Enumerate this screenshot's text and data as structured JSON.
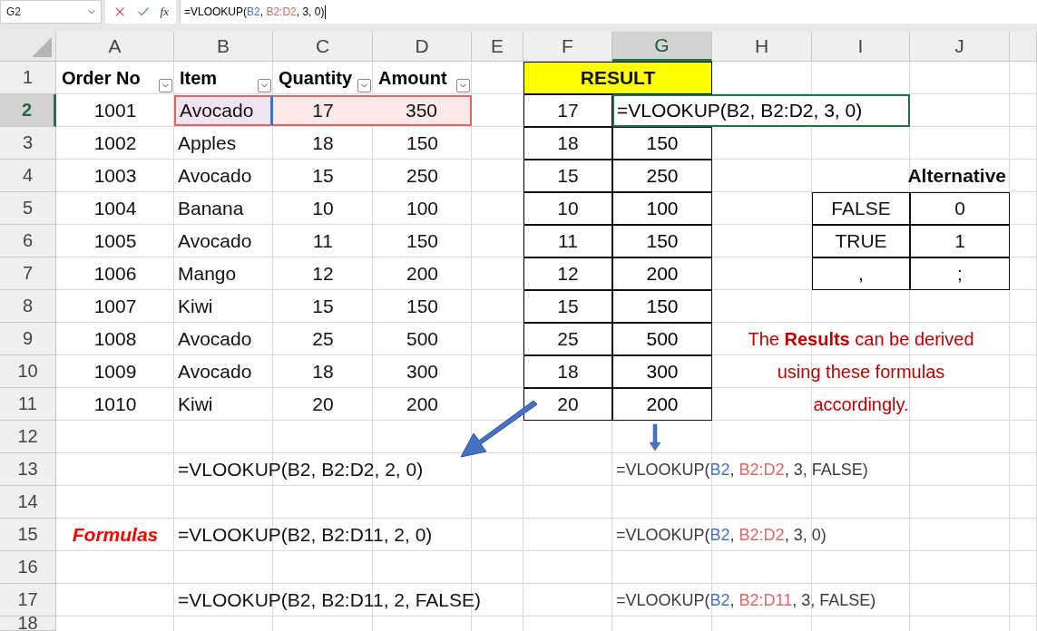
{
  "name_box": {
    "value": "G2"
  },
  "formula_bar": {
    "function_label": "fx",
    "formula": {
      "head": "=VLOOKUP(",
      "lookup_value": "B2",
      "separator": ", ",
      "table_array": "B2:D2",
      "tail": ", 3, 0)"
    }
  },
  "columns": [
    {
      "label": "A",
      "selected": false
    },
    {
      "label": "B",
      "selected": false
    },
    {
      "label": "C",
      "selected": false
    },
    {
      "label": "D",
      "selected": false
    },
    {
      "label": "E",
      "selected": false
    },
    {
      "label": "F",
      "selected": false
    },
    {
      "label": "G",
      "selected": true
    },
    {
      "label": "H",
      "selected": false
    },
    {
      "label": "I",
      "selected": false
    },
    {
      "label": "J",
      "selected": false
    }
  ],
  "rows": [
    {
      "label": "1",
      "selected": false
    },
    {
      "label": "2",
      "selected": true
    },
    {
      "label": "3",
      "selected": false
    },
    {
      "label": "4",
      "selected": false
    },
    {
      "label": "5",
      "selected": false
    },
    {
      "label": "6",
      "selected": false
    },
    {
      "label": "7",
      "selected": false
    },
    {
      "label": "8",
      "selected": false
    },
    {
      "label": "9",
      "selected": false
    },
    {
      "label": "10",
      "selected": false
    },
    {
      "label": "11",
      "selected": false
    },
    {
      "label": "12",
      "selected": false
    },
    {
      "label": "13",
      "selected": false
    },
    {
      "label": "14",
      "selected": false
    },
    {
      "label": "15",
      "selected": false
    },
    {
      "label": "16",
      "selected": false
    },
    {
      "label": "17",
      "selected": false
    },
    {
      "label": "18",
      "selected": false
    }
  ],
  "orders": {
    "headers": [
      "Order No",
      "Item",
      "Quantity",
      "Amount"
    ],
    "rows": [
      {
        "highlighted": true,
        "cells": [
          "1001",
          "Avocado",
          "17",
          "350"
        ]
      },
      {
        "highlighted": false,
        "cells": [
          "1002",
          "Apples",
          "18",
          "150"
        ]
      },
      {
        "highlighted": false,
        "cells": [
          "1003",
          "Avocado",
          "15",
          "250"
        ]
      },
      {
        "highlighted": false,
        "cells": [
          "1004",
          "Banana",
          "10",
          "100"
        ]
      },
      {
        "highlighted": false,
        "cells": [
          "1005",
          "Avocado",
          "11",
          "150"
        ]
      },
      {
        "highlighted": false,
        "cells": [
          "1006",
          "Mango",
          "12",
          "200"
        ]
      },
      {
        "highlighted": false,
        "cells": [
          "1007",
          "Kiwi",
          "15",
          "150"
        ]
      },
      {
        "highlighted": false,
        "cells": [
          "1008",
          "Avocado",
          "25",
          "500"
        ]
      },
      {
        "highlighted": false,
        "cells": [
          "1009",
          "Avocado",
          "18",
          "300"
        ]
      },
      {
        "highlighted": false,
        "cells": [
          "1010",
          "Kiwi",
          "20",
          "200"
        ]
      }
    ]
  },
  "result": {
    "title": "RESULT",
    "rows": [
      {
        "quantity": "17",
        "amount": "=VLOOKUP(B2, B2:D2, 3, 0)",
        "editing": true
      },
      {
        "quantity": "18",
        "amount": "150",
        "editing": false
      },
      {
        "quantity": "15",
        "amount": "250",
        "editing": false
      },
      {
        "quantity": "10",
        "amount": "100",
        "editing": false
      },
      {
        "quantity": "11",
        "amount": "150",
        "editing": false
      },
      {
        "quantity": "12",
        "amount": "200",
        "editing": false
      },
      {
        "quantity": "15",
        "amount": "150",
        "editing": false
      },
      {
        "quantity": "25",
        "amount": "500",
        "editing": false
      },
      {
        "quantity": "18",
        "amount": "300",
        "editing": false
      },
      {
        "quantity": "20",
        "amount": "200",
        "editing": false
      }
    ]
  },
  "alternative": {
    "title": "Alternative",
    "rows": [
      [
        "FALSE",
        "0"
      ],
      [
        "TRUE",
        "1"
      ],
      [
        ",",
        ";"
      ]
    ]
  },
  "note": "The **Results** can be derived using these formulas accordingly.",
  "formulas": {
    "label": "Formulas",
    "left": [
      "=VLOOKUP(B2, B2:D2, 2, 0)",
      "=VLOOKUP(B2, B2:D11, 2, 0)",
      "=VLOOKUP(B2, B2:D11, 2, FALSE)"
    ],
    "right": [
      {
        "head": "=VLOOKUP(",
        "lookup_value": "B2",
        "separator": ", ",
        "table_array": "B2:D2",
        "tail": ", 3, FALSE)"
      },
      {
        "head": "=VLOOKUP(",
        "lookup_value": "B2",
        "separator": ", ",
        "table_array": "B2:D2",
        "tail": ", 3, 0)"
      },
      {
        "head": "=VLOOKUP(",
        "lookup_value": "B2",
        "separator": ", ",
        "table_array": "B2:D11",
        "tail": ", 3, FALSE)"
      }
    ]
  }
}
